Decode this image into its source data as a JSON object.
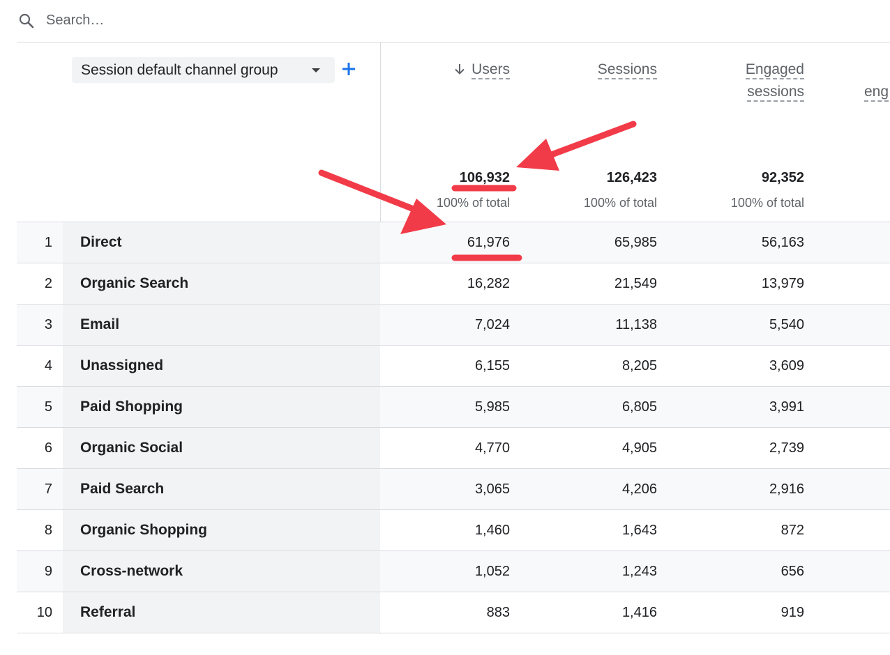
{
  "search": {
    "placeholder": "Search…"
  },
  "dimension": {
    "label": "Session default channel group"
  },
  "metrics": {
    "users_label": "Users",
    "sessions_label": "Sessions",
    "engaged_label_line1": "Engaged",
    "engaged_label_line2": "sessions",
    "partial_label": "eng"
  },
  "totals": {
    "users": "106,932",
    "sessions": "126,423",
    "engaged": "92,352",
    "users_pct": "100% of total",
    "sessions_pct": "100% of total",
    "engaged_pct": "100% of total"
  },
  "rows": [
    {
      "index": "1",
      "channel": "Direct",
      "users": "61,976",
      "sessions": "65,985",
      "engaged": "56,163"
    },
    {
      "index": "2",
      "channel": "Organic Search",
      "users": "16,282",
      "sessions": "21,549",
      "engaged": "13,979"
    },
    {
      "index": "3",
      "channel": "Email",
      "users": "7,024",
      "sessions": "11,138",
      "engaged": "5,540"
    },
    {
      "index": "4",
      "channel": "Unassigned",
      "users": "6,155",
      "sessions": "8,205",
      "engaged": "3,609"
    },
    {
      "index": "5",
      "channel": "Paid Shopping",
      "users": "5,985",
      "sessions": "6,805",
      "engaged": "3,991"
    },
    {
      "index": "6",
      "channel": "Organic Social",
      "users": "4,770",
      "sessions": "4,905",
      "engaged": "2,739"
    },
    {
      "index": "7",
      "channel": "Paid Search",
      "users": "3,065",
      "sessions": "4,206",
      "engaged": "2,916"
    },
    {
      "index": "8",
      "channel": "Organic Shopping",
      "users": "1,460",
      "sessions": "1,643",
      "engaged": "872"
    },
    {
      "index": "9",
      "channel": "Cross-network",
      "users": "1,052",
      "sessions": "1,243",
      "engaged": "656"
    },
    {
      "index": "10",
      "channel": "Referral",
      "users": "883",
      "sessions": "1,416",
      "engaged": "919"
    }
  ],
  "colors": {
    "accent_blue": "#1a73e8",
    "annotation_red": "#f23b48",
    "dimension_bg": "#f1f3f4"
  },
  "icons": {
    "search": "search-icon",
    "dropdown": "dropdown-arrow-icon",
    "add": "add-icon",
    "sort": "sort-descending-icon"
  }
}
